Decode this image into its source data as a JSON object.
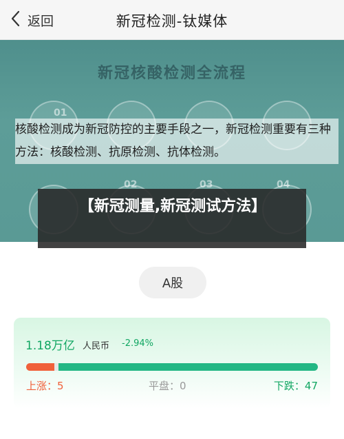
{
  "nav": {
    "back_label": "返回",
    "title": "新冠检测-钛媒体"
  },
  "banner": {
    "headline": "新冠核酸检测全流程",
    "steps": [
      "01",
      "02",
      "03",
      "04"
    ],
    "overlay_text": "核酸检测成为新冠防控的主要手段之一，新冠检测重要有三种方法：核酸检测、抗原检测、抗体检测。"
  },
  "article": {
    "title": "【新冠测量,新冠测试方法】"
  },
  "tag": {
    "label": "A股"
  },
  "market": {
    "amount": "1.18万亿",
    "currency": "人民币",
    "change": "-2.94%",
    "up_fraction": 0.0962,
    "down_fraction": 0.9038,
    "up_label": "上涨：",
    "up_count": "5",
    "flat_label": "平盘：",
    "flat_count": "0",
    "down_label": "下跌：",
    "down_count": "47"
  },
  "colors": {
    "up": "#f0603a",
    "down": "#22b784",
    "accent_green": "#11a662"
  }
}
